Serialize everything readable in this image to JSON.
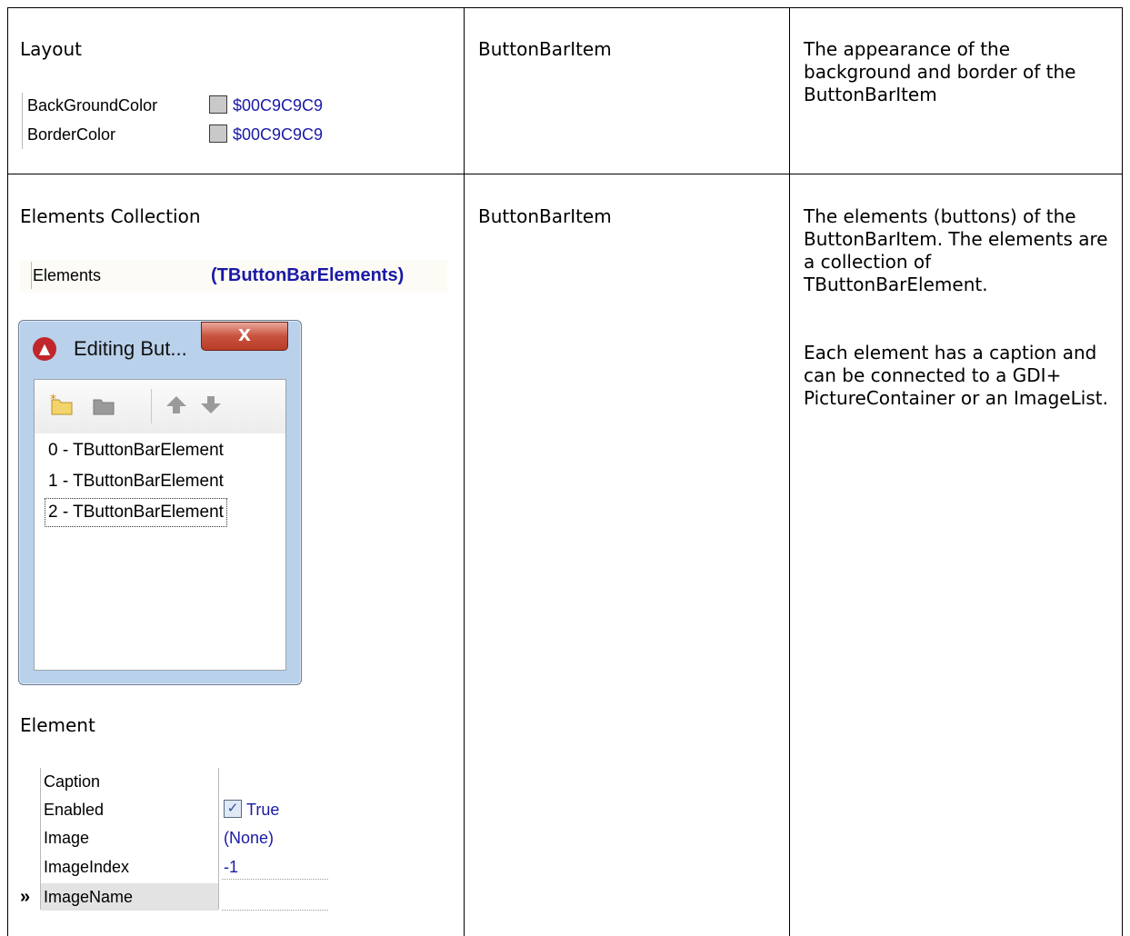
{
  "rows": [
    {
      "heading": "Layout",
      "component": "ButtonBarItem",
      "description": "The appearance of the background and border of the ButtonBarItem",
      "properties": [
        {
          "name": "BackGroundColor",
          "value": "$00C9C9C9",
          "swatch": "#c9c9c9"
        },
        {
          "name": "BorderColor",
          "value": "$00C9C9C9",
          "swatch": "#c9c9c9"
        }
      ]
    },
    {
      "heading": "Elements Collection",
      "component": "ButtonBarItem",
      "description_1": "The elements (buttons) of the ButtonBarItem. The elements are a collection of TButtonBarElement.",
      "description_2": "Each element has a caption and can be connected to a GDI+ PictureContainer or an ImageList.",
      "elements_property": {
        "name": "Elements",
        "value": "(TButtonBarElements)"
      },
      "dialog": {
        "title": "Editing But...",
        "close_glyph": "X",
        "items": [
          "0 - TButtonBarElement",
          "1 - TButtonBarElement",
          "2 - TButtonBarElement"
        ],
        "toolbar_icons": [
          "add-item-icon",
          "delete-item-icon",
          "move-up-icon",
          "move-down-icon"
        ]
      },
      "element_heading": "Element",
      "element_properties": [
        {
          "name": "Caption",
          "value": ""
        },
        {
          "name": "Enabled",
          "value": "True",
          "checked": true
        },
        {
          "name": "Image",
          "value": "(None)"
        },
        {
          "name": "ImageIndex",
          "value": "-1"
        },
        {
          "name": "ImageName",
          "value": "",
          "selected": true,
          "marker": "»"
        }
      ]
    }
  ]
}
